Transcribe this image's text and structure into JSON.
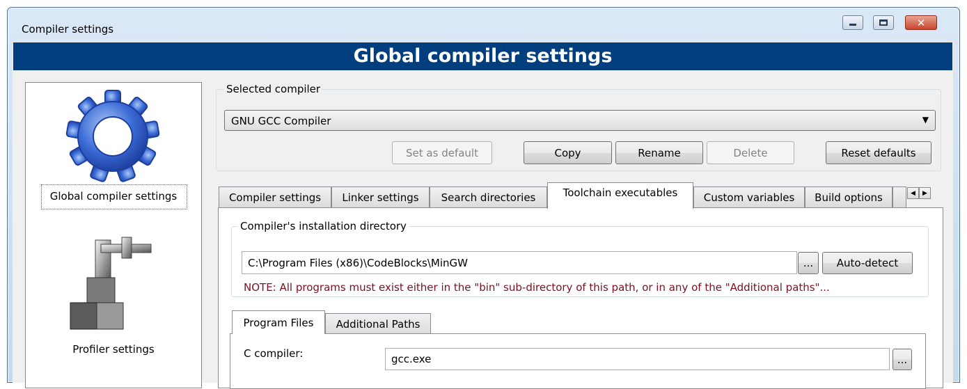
{
  "window": {
    "title": "Compiler settings"
  },
  "banner": {
    "title": "Global compiler settings"
  },
  "sidebar": {
    "items": [
      {
        "label": "Global compiler settings",
        "icon": "gear-icon",
        "selected": true
      },
      {
        "label": "Profiler settings",
        "icon": "profiler-icon",
        "selected": false
      }
    ]
  },
  "selected_compiler": {
    "group_label": "Selected compiler",
    "value": "GNU GCC Compiler",
    "buttons": {
      "set_default": "Set as default",
      "copy": "Copy",
      "rename": "Rename",
      "delete": "Delete",
      "reset": "Reset defaults"
    }
  },
  "tabs": [
    {
      "label": "Compiler settings",
      "active": false
    },
    {
      "label": "Linker settings",
      "active": false
    },
    {
      "label": "Search directories",
      "active": false
    },
    {
      "label": "Toolchain executables",
      "active": true
    },
    {
      "label": "Custom variables",
      "active": false
    },
    {
      "label": "Build options",
      "active": false
    }
  ],
  "install_dir": {
    "group_label": "Compiler's installation directory",
    "value": "C:\\Program Files (x86)\\CodeBlocks\\MinGW",
    "browse_label": "...",
    "autodetect_label": "Auto-detect",
    "note": "NOTE: All programs must exist either in the \"bin\" sub-directory of this path, or in any of the \"Additional paths\"..."
  },
  "subtabs": [
    {
      "label": "Program Files",
      "active": true
    },
    {
      "label": "Additional Paths",
      "active": false
    }
  ],
  "program_files": {
    "c_compiler_label": "C compiler:",
    "c_compiler_value": "gcc.exe",
    "browse_label": "..."
  },
  "colors": {
    "banner": "#003e7e",
    "note_text": "#7a1020",
    "close_button": "#c9462c"
  }
}
